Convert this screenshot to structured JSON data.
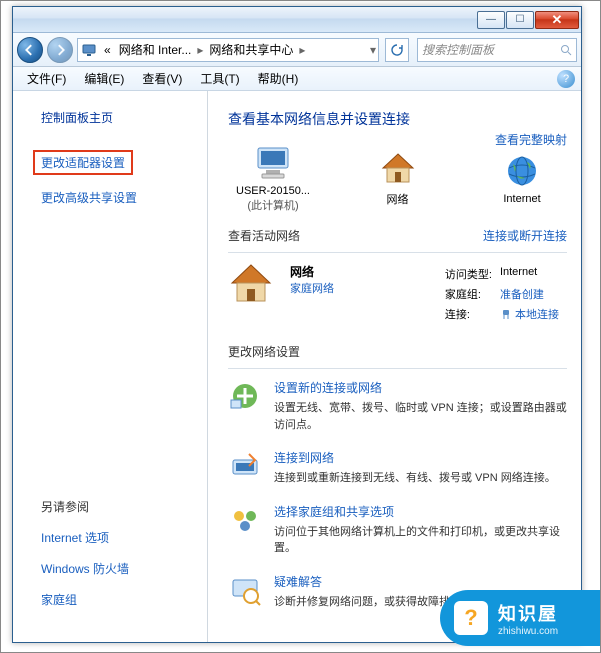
{
  "titlebar": {
    "min": "—",
    "max": "☐",
    "close": "✕"
  },
  "nav": {
    "breadcrumb_prefix": "«",
    "breadcrumb1": "网络和 Inter...",
    "breadcrumb2": "网络和共享中心",
    "search_placeholder": "搜索控制面板"
  },
  "menu": {
    "file": "文件(F)",
    "edit": "编辑(E)",
    "view": "查看(V)",
    "tools": "工具(T)",
    "help": "帮助(H)",
    "question": "?"
  },
  "sidebar": {
    "home": "控制面板主页",
    "adapter": "更改适配器设置",
    "advanced": "更改高级共享设置",
    "see_also": "另请参阅",
    "inet_options": "Internet 选项",
    "firewall": "Windows 防火墙",
    "homegroup": "家庭组"
  },
  "content": {
    "heading": "查看基本网络信息并设置连接",
    "full_map": "查看完整映射",
    "node_pc": "USER-20150...",
    "node_pc_sub": "(此计算机)",
    "node_net": "网络",
    "node_internet": "Internet",
    "active_section": "查看活动网络",
    "active_link": "连接或断开连接",
    "net_name": "网络",
    "net_type": "家庭网络",
    "access_label": "访问类型:",
    "access_value": "Internet",
    "homegroup_label": "家庭组:",
    "homegroup_value": "准备创建",
    "conn_label": "连接:",
    "conn_value": "本地连接",
    "change_section": "更改网络设置",
    "task1_title": "设置新的连接或网络",
    "task1_desc": "设置无线、宽带、拨号、临时或 VPN 连接；或设置路由器或访问点。",
    "task2_title": "连接到网络",
    "task2_desc": "连接到或重新连接到无线、有线、拨号或 VPN 网络连接。",
    "task3_title": "选择家庭组和共享选项",
    "task3_desc": "访问位于其他网络计算机上的文件和打印机，或更改共享设置。",
    "task4_title": "疑难解答",
    "task4_desc": "诊断并修复网络问题，或获得故障排除信息。"
  },
  "badge": {
    "title": "知识屋",
    "url": "zhishiwu.com"
  }
}
